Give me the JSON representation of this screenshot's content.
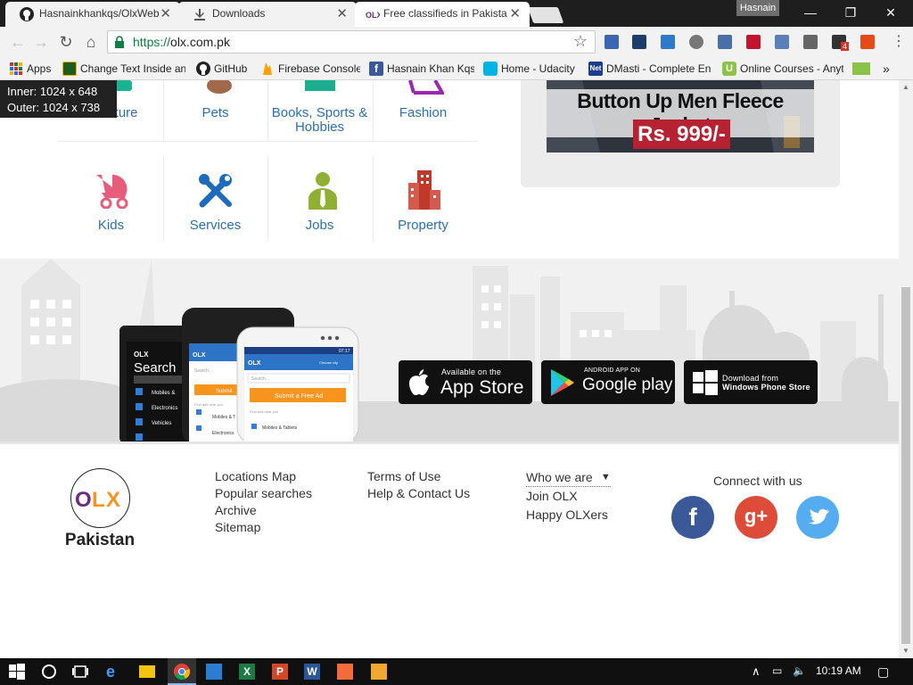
{
  "browser": {
    "tabs": [
      {
        "title": "Hasnainkhankqs/OlxWeb",
        "icon": "github-icon",
        "active": false
      },
      {
        "title": "Downloads",
        "icon": "download-icon",
        "active": false
      },
      {
        "title": "Free classifieds in Pakista",
        "icon": "olx-icon",
        "active": true
      }
    ],
    "user": "Hasnain",
    "url_scheme": "https://",
    "url_host": "olx.com.pk",
    "bookmarks": [
      {
        "label": "Apps",
        "icon": "apps-grid-icon"
      },
      {
        "label": "Change Text Inside an",
        "icon": "android-icon"
      },
      {
        "label": "GitHub",
        "icon": "github-icon"
      },
      {
        "label": "Firebase Console",
        "icon": "firebase-icon"
      },
      {
        "label": "Hasnain Khan Kqs",
        "icon": "facebook-icon"
      },
      {
        "label": "Home - Udacity",
        "icon": "udacity-icon"
      },
      {
        "label": "DMasti - Complete En",
        "icon": "net-icon"
      },
      {
        "label": "Online Courses - Anyt",
        "icon": "udemy-icon"
      }
    ],
    "ext_badge": "4"
  },
  "viewport_tip": {
    "inner": "Inner: 1024 x 648",
    "outer": "Outer: 1024 x 738"
  },
  "categories": {
    "row1": [
      "Furniture",
      "Pets",
      "Books, Sports & Hobbies",
      "Fashion"
    ],
    "row2": [
      "Kids",
      "Services",
      "Jobs",
      "Property"
    ]
  },
  "ad": {
    "title": "Button Up Men Fleece Jacket",
    "price": "Rs. 999/-"
  },
  "phones": {
    "tablet_search": "Search",
    "search_placeholder": "Search...",
    "submit": "Submit a Free Ad",
    "choose_city": "Choose city",
    "time": "07:17",
    "find_ads": "Find ads near you",
    "mobiles": "Mobiles & Tablets",
    "electronics": "Electronics",
    "vehicles": "Vehicles"
  },
  "stores": {
    "apple": {
      "small": "Available on the",
      "big": "App Store"
    },
    "google": {
      "small": "ANDROID APP ON",
      "big": "Google play"
    },
    "windows": {
      "small": "Download from",
      "big": "Windows Phone Store"
    }
  },
  "footer": {
    "country": "Pakistan",
    "col1": [
      "Locations Map",
      "Popular searches",
      "Archive",
      "Sitemap"
    ],
    "col2": [
      "Terms of Use",
      "Help & Contact Us"
    ],
    "col3": [
      "Who we are",
      "Join OLX",
      "Happy OLXers"
    ],
    "connect": "Connect with us"
  },
  "taskbar": {
    "time": "10:19 AM"
  },
  "colors": {
    "olx_purple": "#6b2c7d",
    "olx_orange": "#f7941d",
    "link_blue": "#2b6fb3",
    "facebook": "#3b5998",
    "gplus": "#dd4b39",
    "twitter": "#55acee"
  }
}
